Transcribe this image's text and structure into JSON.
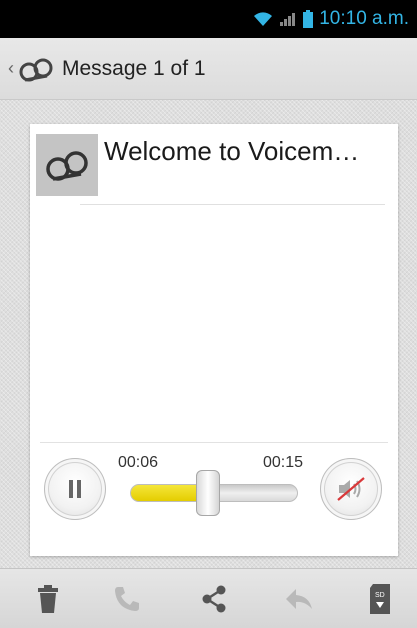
{
  "status_bar": {
    "time": "10:10 a.m.",
    "icons": [
      "wifi-icon",
      "signal-icon",
      "battery-icon"
    ],
    "accent_color": "#33b5e5"
  },
  "action_bar": {
    "back_icon": "chevron-left-icon",
    "logo_icon": "voicemail-logo-icon",
    "title": "Message 1 of 1"
  },
  "message": {
    "avatar_icon": "voicemail-logo-icon",
    "title": "Welcome to Voicem…"
  },
  "player": {
    "state": "playing",
    "elapsed": "00:06",
    "total": "00:15",
    "progress_fraction": 0.4,
    "pause_icon": "pause-icon",
    "mute_icon": "speaker-muted-icon",
    "progress_color": "#e8d300"
  },
  "toolbar": {
    "items": [
      {
        "icon": "trash-icon",
        "enabled": true
      },
      {
        "icon": "phone-icon",
        "enabled": false
      },
      {
        "icon": "share-icon",
        "enabled": true
      },
      {
        "icon": "reply-icon",
        "enabled": false
      },
      {
        "icon": "sd-card-save-icon",
        "enabled": true
      }
    ]
  }
}
